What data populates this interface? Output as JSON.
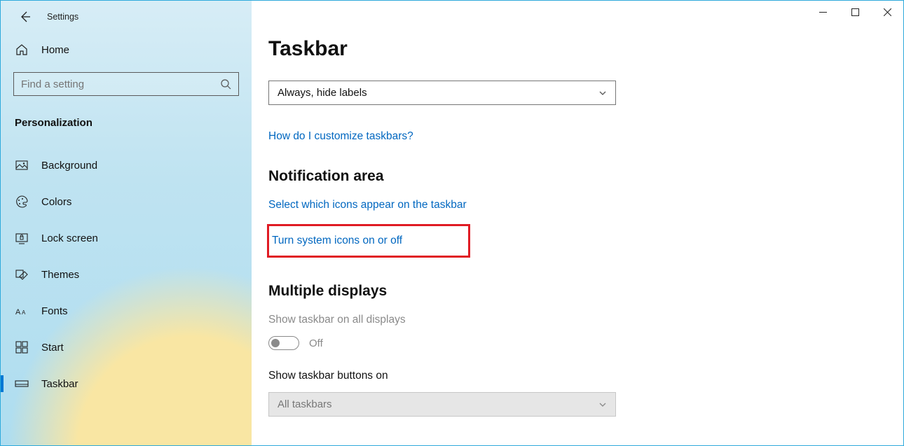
{
  "app": {
    "title": "Settings"
  },
  "sidebar": {
    "home": "Home",
    "search_placeholder": "Find a setting",
    "section": "Personalization",
    "items": [
      {
        "label": "Background"
      },
      {
        "label": "Colors"
      },
      {
        "label": "Lock screen"
      },
      {
        "label": "Themes"
      },
      {
        "label": "Fonts"
      },
      {
        "label": "Start"
      },
      {
        "label": "Taskbar"
      }
    ]
  },
  "main": {
    "page_title": "Taskbar",
    "truncated_heading": "",
    "combine_dropdown": "Always, hide labels",
    "help_link": "How do I customize taskbars?",
    "notification_heading": "Notification area",
    "select_icons_link": "Select which icons appear on the taskbar",
    "turn_system_icons_link": "Turn system icons on or off",
    "multiple_displays_heading": "Multiple displays",
    "show_taskbar_all_label": "Show taskbar on all displays",
    "toggle_state": "Off",
    "show_taskbar_buttons_label": "Show taskbar buttons on",
    "all_taskbars_dropdown": "All taskbars"
  }
}
